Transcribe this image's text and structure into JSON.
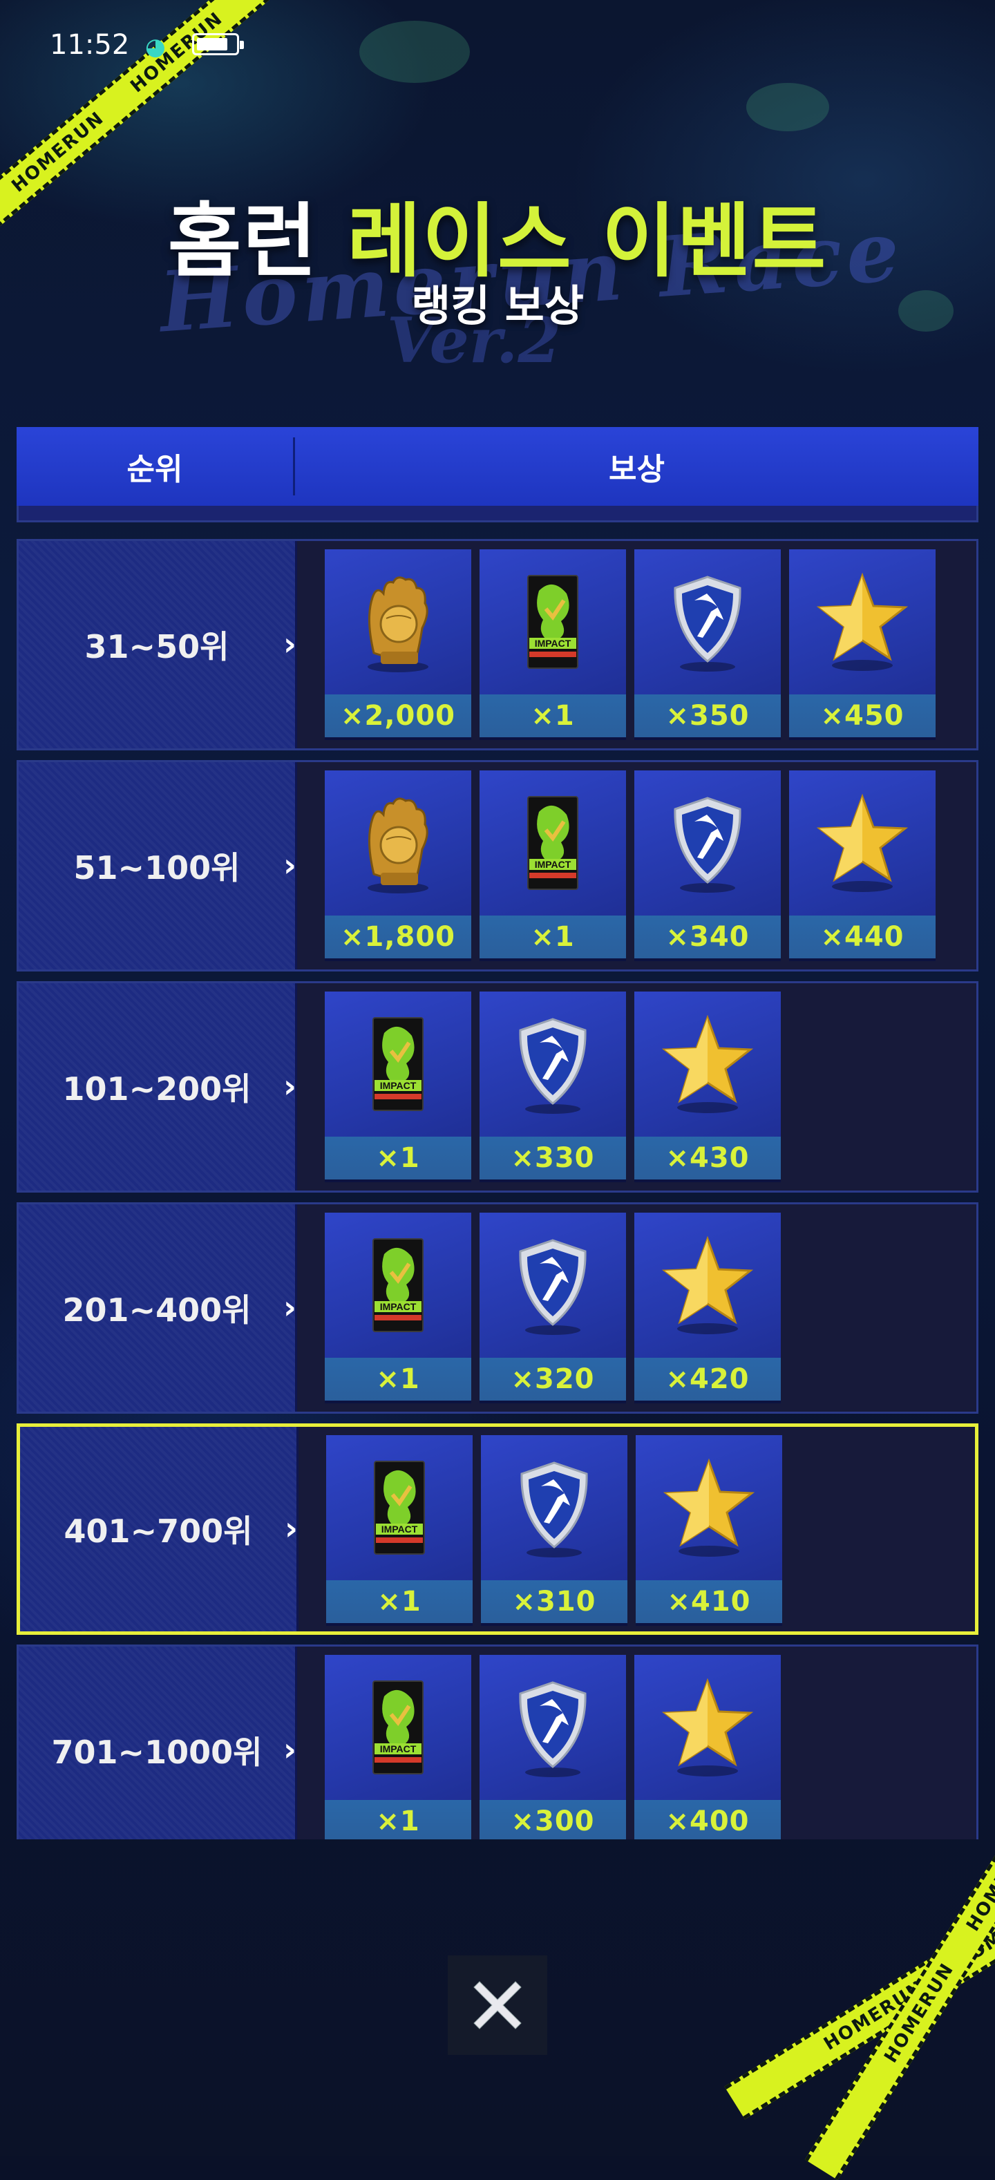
{
  "status_bar": {
    "time": "11:52"
  },
  "title": {
    "line1_white": "홈런",
    "line1_green": "레이스 이벤트",
    "line2": "랭킹 보상",
    "art_text": "Homerun Race",
    "art_ver": "Ver.2"
  },
  "tape_text": "HOMERUN",
  "table": {
    "col_rank": "순위",
    "col_reward": "보상",
    "rows": [
      {
        "rank": "31~50위",
        "items": [
          {
            "icon": "golden-glove-icon",
            "qty": "×2,000"
          },
          {
            "icon": "impact-pack-icon",
            "qty": "×1"
          },
          {
            "icon": "shield-badge-icon",
            "qty": "×350"
          },
          {
            "icon": "star-icon",
            "qty": "×450"
          }
        ]
      },
      {
        "rank": "51~100위",
        "items": [
          {
            "icon": "golden-glove-icon",
            "qty": "×1,800"
          },
          {
            "icon": "impact-pack-icon",
            "qty": "×1"
          },
          {
            "icon": "shield-badge-icon",
            "qty": "×340"
          },
          {
            "icon": "star-icon",
            "qty": "×440"
          }
        ]
      },
      {
        "rank": "101~200위",
        "items": [
          {
            "icon": "impact-pack-icon",
            "qty": "×1"
          },
          {
            "icon": "shield-badge-icon",
            "qty": "×330"
          },
          {
            "icon": "star-icon",
            "qty": "×430"
          }
        ]
      },
      {
        "rank": "201~400위",
        "items": [
          {
            "icon": "impact-pack-icon",
            "qty": "×1"
          },
          {
            "icon": "shield-badge-icon",
            "qty": "×320"
          },
          {
            "icon": "star-icon",
            "qty": "×420"
          }
        ]
      },
      {
        "rank": "401~700위",
        "highlighted": true,
        "items": [
          {
            "icon": "impact-pack-icon",
            "qty": "×1"
          },
          {
            "icon": "shield-badge-icon",
            "qty": "×310"
          },
          {
            "icon": "star-icon",
            "qty": "×410"
          }
        ]
      },
      {
        "rank": "701~1000위",
        "items": [
          {
            "icon": "impact-pack-icon",
            "qty": "×1"
          },
          {
            "icon": "shield-badge-icon",
            "qty": "×300"
          },
          {
            "icon": "star-icon",
            "qty": "×400"
          }
        ]
      }
    ]
  },
  "close_button": {
    "icon": "close-icon"
  },
  "colors": {
    "accent_green": "#d4f23a",
    "header_blue": "#2a44d8",
    "highlight_border": "#e7ef3a",
    "tape_yellow": "#d8f21f"
  }
}
